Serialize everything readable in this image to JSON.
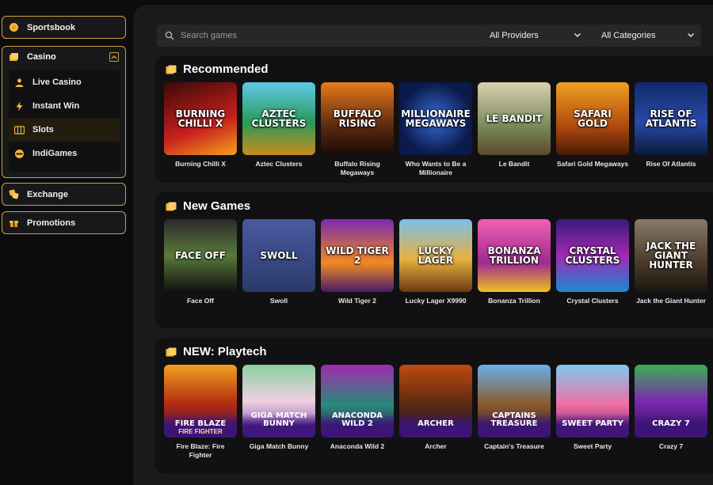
{
  "sidebar": {
    "sportsbook": "Sportsbook",
    "casino": {
      "label": "Casino",
      "items": [
        {
          "label": "Live Casino",
          "icon": "live-casino-icon"
        },
        {
          "label": "Instant Win",
          "icon": "lightning-icon"
        },
        {
          "label": "Slots",
          "icon": "slots-icon"
        },
        {
          "label": "IndiGames",
          "icon": "indigames-icon"
        }
      ]
    },
    "exchange": "Exchange",
    "promotions": "Promotions"
  },
  "toolbar": {
    "search_placeholder": "Search games",
    "providers": "All Providers",
    "categories": "All Categories"
  },
  "colors": {
    "accent": "#c9a23a",
    "panel": "#1a1a1d",
    "section": "#111113"
  },
  "sections": [
    {
      "title": "Recommended",
      "games": [
        {
          "name": "Burning Chilli X",
          "art": "BURNING CHILLI X",
          "bg": "linear-gradient(160deg,#3a0a08,#c8201c 60%,#f5a020)"
        },
        {
          "name": "Aztec Clusters",
          "art": "AZTEC CLUSTERS",
          "bg": "linear-gradient(180deg,#5fc8e8,#2a9a5a 55%,#c98b1c)"
        },
        {
          "name": "Buffalo Rising Megaways",
          "art": "BUFFALO RISING",
          "bg": "linear-gradient(180deg,#e87a1a,#5a2a10 60%,#1a0a05)"
        },
        {
          "name": "Who Wants to Be a Millionaire",
          "art": "MILLIONAIRE MEGAWAYS",
          "bg": "radial-gradient(circle,#3a6ad8,#0a1a4a 70%)"
        },
        {
          "name": "Le Bandit",
          "art": "LE BANDIT",
          "bg": "linear-gradient(180deg,#d8d0b0,#7a8a5a 60%,#5a4a2a)"
        },
        {
          "name": "Safari Gold Megaways",
          "art": "SAFARI GOLD",
          "bg": "linear-gradient(180deg,#f0a020,#b04a10 60%,#4a1a05)"
        },
        {
          "name": "Rise Of Atlantis",
          "art": "RISE OF ATLANTIS",
          "bg": "linear-gradient(180deg,#102a6a,#2a4aa8 55%,#0a1a3a)"
        }
      ]
    },
    {
      "title": "New Games",
      "games": [
        {
          "name": "Face Off",
          "art": "FACE OFF",
          "bg": "linear-gradient(180deg,#2a2a2a,#5a7a3a 50%,#101010)"
        },
        {
          "name": "Swoll",
          "art": "SWOLL",
          "bg": "linear-gradient(180deg,#4a5aa0,#2a3a6a)"
        },
        {
          "name": "Wild Tiger 2",
          "art": "WILD TIGER 2",
          "bg": "linear-gradient(180deg,#7a2ab0,#f08a20 60%,#4a1a6a)"
        },
        {
          "name": "Lucky Lager X9990",
          "art": "LUCKY LAGER",
          "bg": "linear-gradient(180deg,#7ac0e8,#e8b040 55%,#6a3a10)"
        },
        {
          "name": "Bonanza Trillion",
          "art": "BONANZA TRILLION",
          "bg": "linear-gradient(180deg,#f060b0,#a02a90 60%,#f0c020)"
        },
        {
          "name": "Crystal Clusters",
          "art": "CRYSTAL CLUSTERS",
          "bg": "linear-gradient(180deg,#3a1a7a,#a02ab0 50%,#1a8ad0)"
        },
        {
          "name": "Jack the Giant Hunter",
          "art": "JACK THE GIANT HUNTER",
          "bg": "linear-gradient(180deg,#8a7a6a,#4a3a2a 60%,#1a1510)"
        }
      ]
    },
    {
      "title": "NEW: Playtech",
      "games": [
        {
          "name": "Fire Blaze: Fire Fighter",
          "art": "FIRE BLAZE",
          "sub": "FIRE FIGHTER",
          "bg": "linear-gradient(180deg,#f0a020,#b02a10 55%,#3a1060)"
        },
        {
          "name": "Giga Match Bunny",
          "art": "GIGA MATCH BUNNY",
          "sub": "",
          "bg": "linear-gradient(180deg,#8ad0a0,#f0d0e0 50%,#6a3ab0)"
        },
        {
          "name": "Anaconda Wild 2",
          "art": "ANACONDA WILD 2",
          "sub": "",
          "bg": "linear-gradient(180deg,#a02ab0,#2a8a7a 55%,#3a1060)"
        },
        {
          "name": "Archer",
          "art": "ARCHER",
          "sub": "",
          "bg": "linear-gradient(180deg,#c04a10,#5a2a10 55%,#2a1050)"
        },
        {
          "name": "Captain's Treasure",
          "art": "CAPTAINS TREASURE",
          "sub": "",
          "bg": "linear-gradient(180deg,#6ab0e8,#8a5a2a 55%,#2a1050)"
        },
        {
          "name": "Sweet Party",
          "art": "SWEET PARTY",
          "sub": "",
          "bg": "linear-gradient(180deg,#80c8f0,#f070a0 55%,#5a1a80)"
        },
        {
          "name": "Crazy 7",
          "art": "CRAZY 7",
          "sub": "",
          "bg": "linear-gradient(180deg,#3ab050,#7a2ab0 50%,#2a1050)"
        }
      ]
    }
  ]
}
